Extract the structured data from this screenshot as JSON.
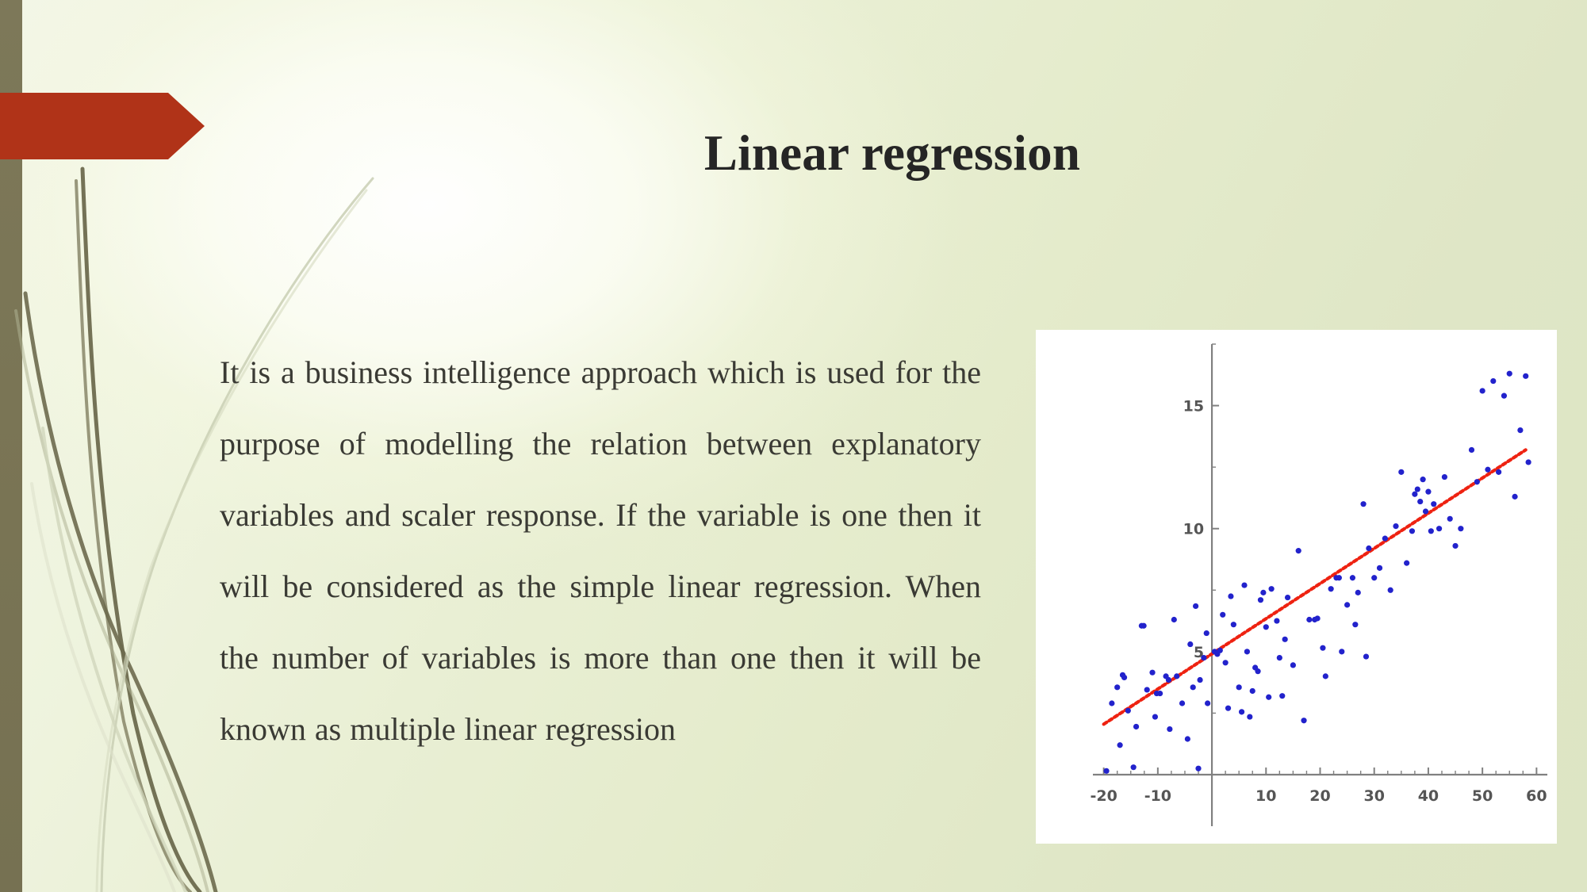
{
  "slide": {
    "title": "Linear regression",
    "body": "It is a business intelligence approach which is used for the purpose of modelling the relation between explanatory variables and scaler response. If the variable is one then it will be considered as the simple linear regression. When the number of variables is more than one then it will be known as multiple linear regression"
  },
  "theme": {
    "banner_color": "#b03318",
    "left_band_color": "#7a7555",
    "background_start": "#f3f6e8",
    "background_end": "#dfe6c6",
    "title_color": "#252525",
    "body_color": "#3a3a34",
    "grass_dark": "#6d6a4e",
    "grass_light": "#c9cfb4"
  },
  "chart_data": {
    "type": "scatter",
    "title": "",
    "xlabel": "",
    "ylabel": "",
    "xlim": [
      -22,
      62
    ],
    "ylim": [
      -1,
      17.5
    ],
    "xticks": [
      -20,
      -10,
      10,
      20,
      30,
      40,
      50,
      60
    ],
    "xticklabels": [
      "-20",
      "-10",
      "10",
      "20",
      "30",
      "40",
      "50",
      "60"
    ],
    "yticks": [
      5,
      10,
      15
    ],
    "yticklabels": [
      "5",
      "10",
      "15"
    ],
    "minor_tick_step": 2.5,
    "grid": false,
    "legend": false,
    "point_color": "#2222cc",
    "line_color": "#ee2211",
    "line_style": "dotted",
    "axis_color": "#808080",
    "background": "#ffffff",
    "fit_line": {
      "x": [
        -20,
        58
      ],
      "y": [
        2.05,
        13.2
      ],
      "slope": 0.143,
      "intercept": 4.91
    },
    "points": [
      [
        -19.5,
        0.15
      ],
      [
        -18.5,
        2.9
      ],
      [
        -17.5,
        3.55
      ],
      [
        -17.0,
        1.2
      ],
      [
        -16.5,
        4.05
      ],
      [
        -16.2,
        3.95
      ],
      [
        -15.5,
        2.6
      ],
      [
        -14.5,
        0.3
      ],
      [
        -14.0,
        1.95
      ],
      [
        -13.0,
        6.05
      ],
      [
        -12.6,
        6.05
      ],
      [
        -12.0,
        3.45
      ],
      [
        -11.0,
        4.15
      ],
      [
        -10.5,
        2.35
      ],
      [
        -10.2,
        3.3
      ],
      [
        -9.6,
        3.3
      ],
      [
        -8.5,
        4.0
      ],
      [
        -8.0,
        3.85
      ],
      [
        -7.8,
        1.85
      ],
      [
        -7.0,
        6.3
      ],
      [
        -6.5,
        4.0
      ],
      [
        -5.5,
        2.9
      ],
      [
        -4.5,
        1.45
      ],
      [
        -4.0,
        5.3
      ],
      [
        -3.5,
        3.55
      ],
      [
        -3.0,
        6.85
      ],
      [
        -2.5,
        0.25
      ],
      [
        -2.2,
        3.85
      ],
      [
        -1.5,
        4.75
      ],
      [
        -1.0,
        5.75
      ],
      [
        -0.8,
        2.9
      ],
      [
        0.5,
        5.0
      ],
      [
        1.0,
        4.9
      ],
      [
        1.5,
        5.05
      ],
      [
        2.0,
        6.5
      ],
      [
        2.5,
        4.55
      ],
      [
        3.0,
        2.7
      ],
      [
        3.5,
        7.25
      ],
      [
        4.0,
        6.1
      ],
      [
        5.0,
        3.55
      ],
      [
        5.5,
        2.55
      ],
      [
        6.0,
        7.7
      ],
      [
        6.5,
        5.0
      ],
      [
        7.0,
        2.35
      ],
      [
        7.5,
        3.4
      ],
      [
        8.0,
        4.35
      ],
      [
        8.5,
        4.2
      ],
      [
        9.0,
        7.1
      ],
      [
        9.5,
        7.4
      ],
      [
        10.0,
        6.0
      ],
      [
        10.5,
        3.15
      ],
      [
        11.0,
        7.55
      ],
      [
        12.0,
        6.25
      ],
      [
        12.5,
        4.75
      ],
      [
        13.0,
        3.2
      ],
      [
        13.5,
        5.5
      ],
      [
        14.0,
        7.2
      ],
      [
        15.0,
        4.45
      ],
      [
        16.0,
        9.1
      ],
      [
        17.0,
        2.2
      ],
      [
        18.0,
        6.3
      ],
      [
        19.0,
        6.3
      ],
      [
        19.5,
        6.35
      ],
      [
        20.5,
        5.15
      ],
      [
        21.0,
        4.0
      ],
      [
        22.0,
        7.55
      ],
      [
        23.0,
        8.0
      ],
      [
        23.5,
        8.0
      ],
      [
        24.0,
        5.0
      ],
      [
        25.0,
        6.9
      ],
      [
        26.0,
        8.0
      ],
      [
        26.5,
        6.1
      ],
      [
        27.0,
        7.4
      ],
      [
        28.0,
        11.0
      ],
      [
        28.5,
        4.8
      ],
      [
        29.0,
        9.2
      ],
      [
        30.0,
        8.0
      ],
      [
        31.0,
        8.4
      ],
      [
        32.0,
        9.6
      ],
      [
        33.0,
        7.5
      ],
      [
        34.0,
        10.1
      ],
      [
        35.0,
        12.3
      ],
      [
        36.0,
        8.6
      ],
      [
        37.0,
        9.9
      ],
      [
        37.5,
        11.4
      ],
      [
        38.0,
        11.6
      ],
      [
        38.5,
        11.1
      ],
      [
        39.0,
        12.0
      ],
      [
        39.5,
        10.7
      ],
      [
        40.0,
        11.5
      ],
      [
        40.5,
        9.9
      ],
      [
        41.0,
        11.0
      ],
      [
        42.0,
        10.0
      ],
      [
        43.0,
        12.1
      ],
      [
        44.0,
        10.4
      ],
      [
        45.0,
        9.3
      ],
      [
        46.0,
        10.0
      ],
      [
        48.0,
        13.2
      ],
      [
        49.0,
        11.9
      ],
      [
        50.0,
        15.6
      ],
      [
        51.0,
        12.4
      ],
      [
        52.0,
        16.0
      ],
      [
        53.0,
        12.3
      ],
      [
        54.0,
        15.4
      ],
      [
        55.0,
        16.3
      ],
      [
        56.0,
        11.3
      ],
      [
        57.0,
        14.0
      ],
      [
        58.0,
        16.2
      ],
      [
        58.5,
        12.7
      ]
    ]
  }
}
